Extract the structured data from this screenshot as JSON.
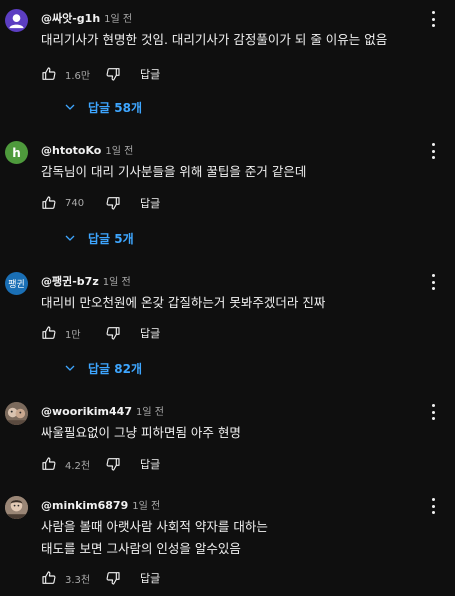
{
  "comments": [
    {
      "handle": "@싸앗-g1h",
      "time": "1일 전",
      "text": "대리기사가 현명한 것임. 대리기사가 감정풀이가 되 줄 이유는 없음",
      "likes": "1.6만",
      "reply_label": "답글",
      "replies_label": "답글 58개",
      "avatar_color": "#5c3ec2",
      "avatar_icon": "person-icon"
    },
    {
      "handle": "@htotoKo",
      "time": "1일 전",
      "text": "감독님이 대리 기사분들을 위해 꿀팁을 준거 같은데",
      "likes": "740",
      "reply_label": "답글",
      "replies_label": "답글 5개",
      "avatar_color": "#4e9a3c",
      "avatar_letter": "h"
    },
    {
      "handle": "@팽귄-b7z",
      "time": "1일 전",
      "text": "대리비 만오천원에 온갖 갑질하는거 못봐주겠더라 진짜",
      "likes": "1만",
      "reply_label": "답글",
      "replies_label": "답글 82개",
      "avatar_color": "#1a6fb5",
      "avatar_letter": "팽귄"
    },
    {
      "handle": "@woorikim447",
      "time": "1일 전",
      "text": "싸울필요없이 그냥 피하면됨 아주 현명",
      "likes": "4.2천",
      "reply_label": "답글",
      "avatar_color": "#6b5a4e",
      "avatar_icon": "photo-avatar-icon"
    },
    {
      "handle": "@minkim6879",
      "time": "1일 전",
      "text": "사람을 볼때  아랫사람  사회적 약자를 대하는\n태도를 보면  그사람의 인성을 알수있음",
      "likes": "3.3천",
      "reply_label": "답글",
      "avatar_color": "#8a7565",
      "avatar_icon": "photo-avatar-icon"
    }
  ],
  "colors": {
    "background": "#0f0f0f",
    "text": "#f1f1f1",
    "secondary": "#aaaaaa",
    "link": "#3ea6ff"
  }
}
